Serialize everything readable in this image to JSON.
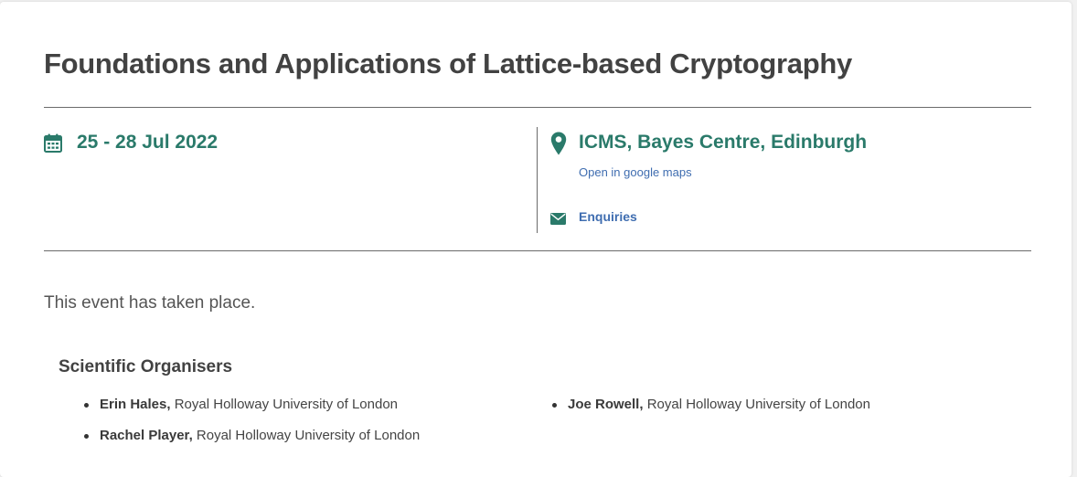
{
  "event": {
    "title": "Foundations and Applications of Lattice-based Cryptography",
    "date": "25 - 28 Jul 2022",
    "venue": "ICMS, Bayes Centre, Edinburgh",
    "maps_link": "Open in google maps",
    "enquiries_link": "Enquiries",
    "status": "This event has taken place."
  },
  "organisers": {
    "heading": "Scientific Organisers",
    "left": [
      {
        "name": "Erin Hales,",
        "affiliation": " Royal Holloway University of London"
      },
      {
        "name": "Rachel Player,",
        "affiliation": " Royal Holloway University of London"
      }
    ],
    "right": [
      {
        "name": "Joe Rowell,",
        "affiliation": " Royal Holloway University of London"
      }
    ]
  },
  "icons": {
    "date": "calendar-icon",
    "venue": "map-pin-icon",
    "enquiries": "envelope-icon"
  },
  "colors": {
    "accent": "#2a7a6a",
    "link": "#3f6db0",
    "text": "#424242",
    "divider": "#6b6b6b"
  }
}
